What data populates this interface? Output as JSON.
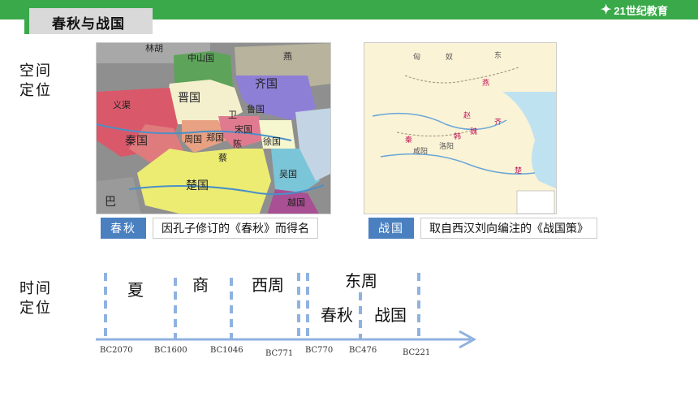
{
  "header": {
    "title": "春秋与战国",
    "logo_text": "21世纪教育"
  },
  "labels": {
    "space": [
      "空间",
      "定位"
    ],
    "time": [
      "时间",
      "定位"
    ]
  },
  "maps": {
    "left": {
      "tag": "春秋",
      "caption": "因孔子修订的《春秋》而得名",
      "regions": [
        "中山国",
        "晋国",
        "齐国",
        "鲁国",
        "卫",
        "宋国",
        "郑国",
        "周国",
        "陈",
        "蔡",
        "徐国",
        "秦国",
        "楚国",
        "吴国",
        "越国",
        "巴",
        "义渠",
        "林胡",
        "燕"
      ]
    },
    "right": {
      "tag": "战国",
      "caption": "取自西汉刘向编注的《战国策》",
      "regions": [
        "匈",
        "奴",
        "东",
        "赵",
        "燕",
        "韩",
        "魏",
        "秦",
        "齐",
        "楚",
        "咸阳",
        "洛阳"
      ]
    }
  },
  "timeline": {
    "periods": [
      "夏",
      "商",
      "西周",
      "东周",
      "春秋",
      "战国"
    ],
    "ticks": [
      "BC2070",
      "BC1600",
      "BC1046",
      "BC771",
      "BC770",
      "BC476",
      "BC221"
    ]
  },
  "colors": {
    "accent_green": "#3aa94a",
    "tag_blue": "#4a80c0",
    "timeline_blue": "#8fb2e0"
  }
}
